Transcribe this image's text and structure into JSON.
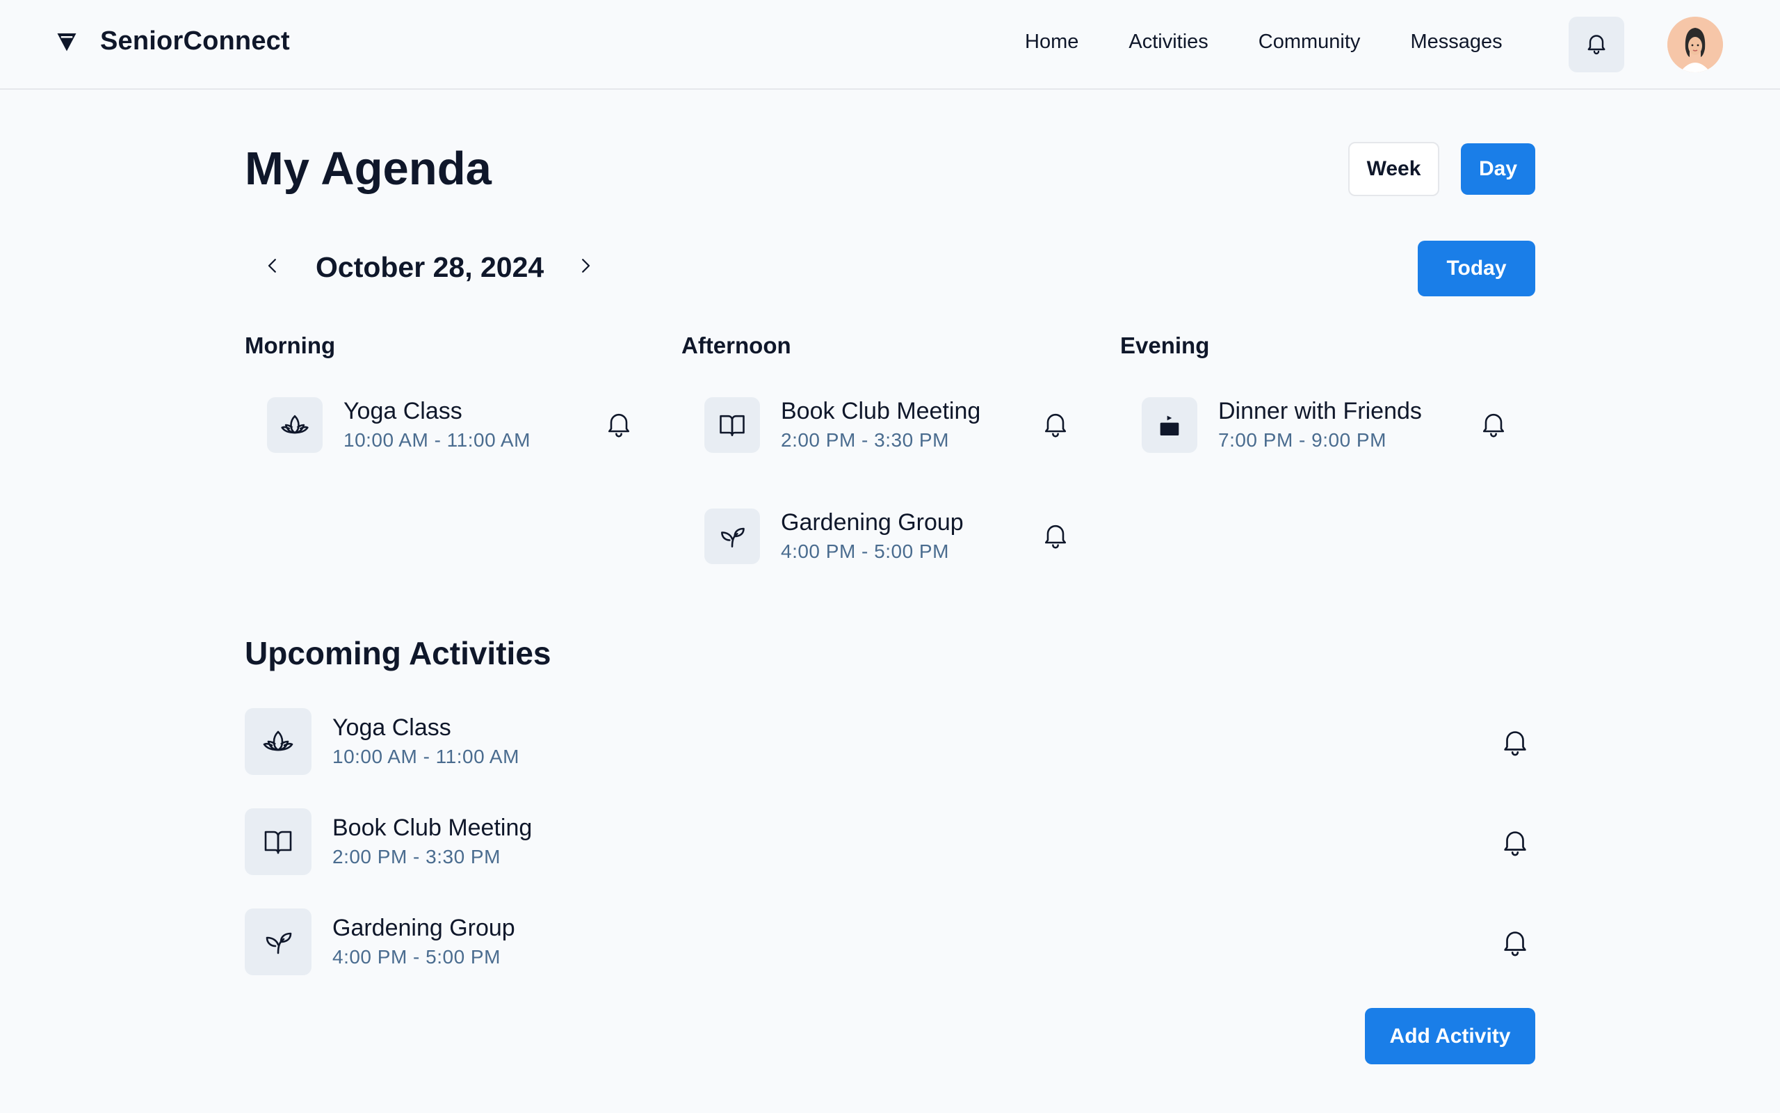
{
  "header": {
    "brand": "SeniorConnect",
    "nav": [
      "Home",
      "Activities",
      "Community",
      "Messages"
    ]
  },
  "main": {
    "title": "My Agenda",
    "view_toggle": {
      "week": "Week",
      "day": "Day",
      "selected": "Day"
    },
    "date": "October 28, 2024",
    "today_label": "Today",
    "columns": {
      "morning": {
        "label": "Morning",
        "items": [
          {
            "title": "Yoga Class",
            "time": "10:00 AM - 11:00 AM",
            "icon": "lotus-icon"
          }
        ]
      },
      "afternoon": {
        "label": "Afternoon",
        "items": [
          {
            "title": "Book Club Meeting",
            "time": "2:00 PM - 3:30 PM",
            "icon": "book-icon"
          },
          {
            "title": "Gardening Group",
            "time": "4:00 PM - 5:00 PM",
            "icon": "sprout-icon"
          }
        ]
      },
      "evening": {
        "label": "Evening",
        "items": [
          {
            "title": "Dinner with Friends",
            "time": "7:00 PM - 9:00 PM",
            "icon": "dinner-icon"
          }
        ]
      }
    },
    "upcoming": {
      "title": "Upcoming Activities",
      "items": [
        {
          "title": "Yoga Class",
          "time": "10:00 AM - 11:00 AM",
          "icon": "lotus-icon"
        },
        {
          "title": "Book Club Meeting",
          "time": "2:00 PM - 3:30 PM",
          "icon": "book-icon"
        },
        {
          "title": "Gardening Group",
          "time": "4:00 PM - 5:00 PM",
          "icon": "sprout-icon"
        }
      ]
    },
    "add_activity_label": "Add Activity"
  },
  "colors": {
    "accent": "#1a7ee8",
    "time_text": "#4a6c8f",
    "icon_bg": "#e8edf3"
  }
}
